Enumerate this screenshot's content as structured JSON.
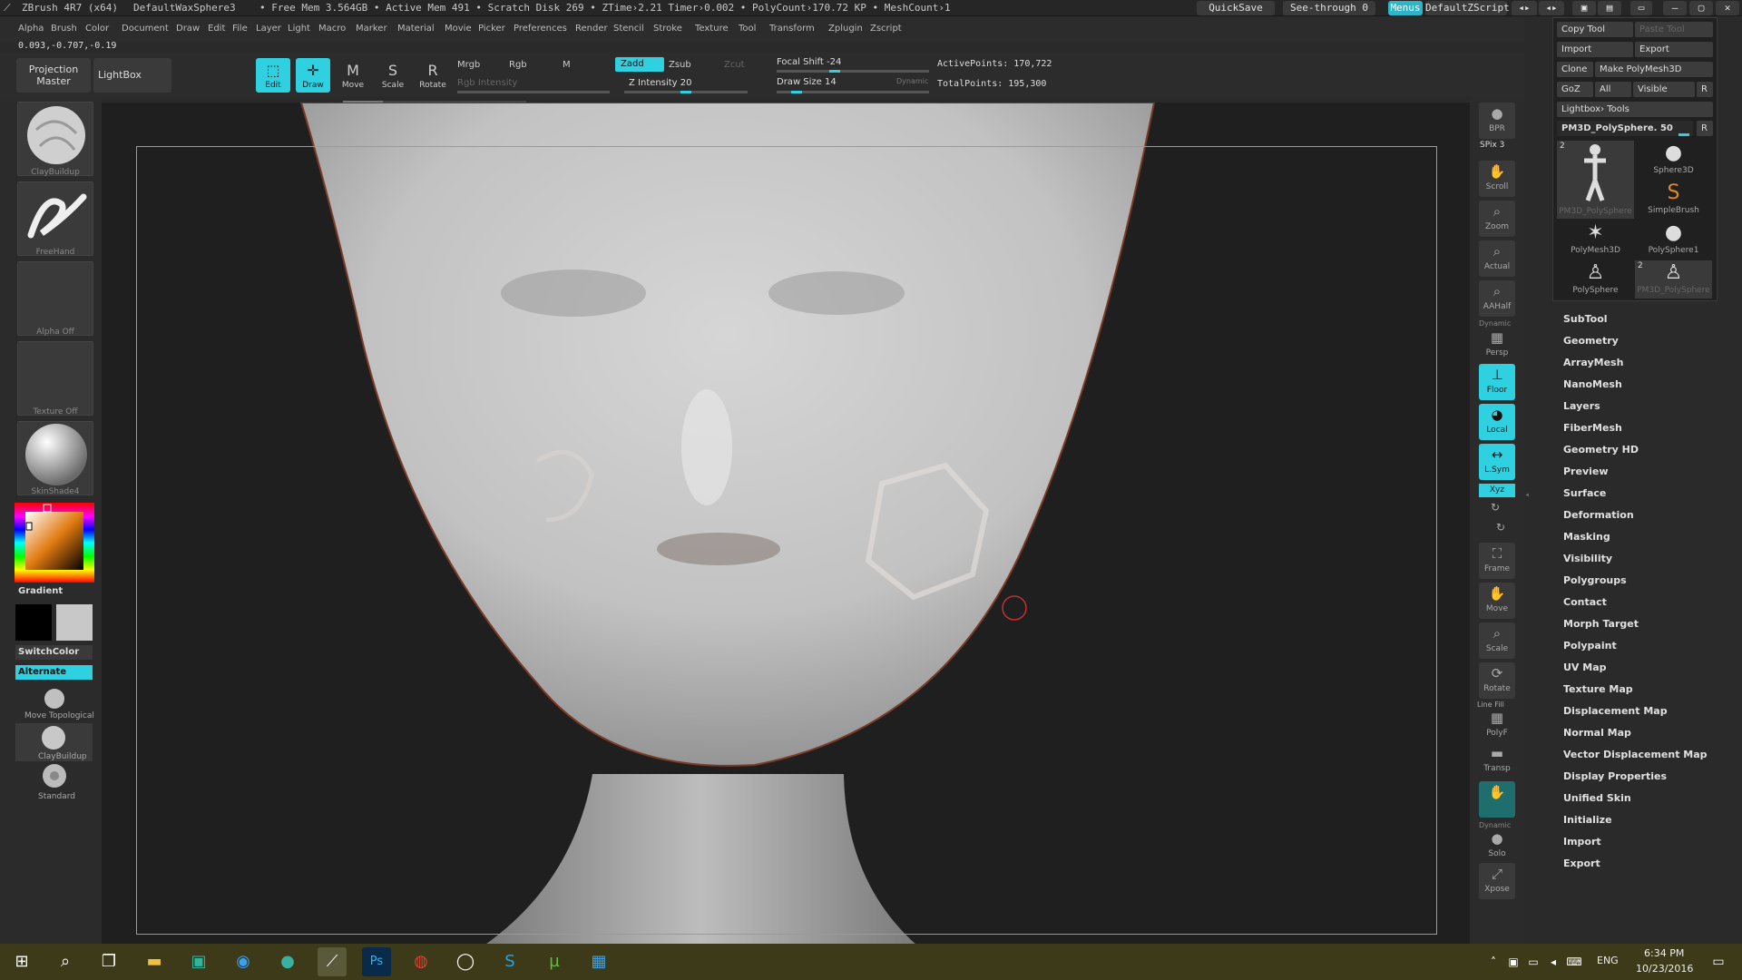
{
  "titlebar": {
    "app": "ZBrush 4R7 (x64)",
    "doc": "DefaultWaxSphere3",
    "stats": "• Free Mem 3.564GB • Active Mem 491 • Scratch Disk 269 • ZTime›2.21 Timer›0.002 • PolyCount›170.72 KP • MeshCount›1",
    "quicksave": "QuickSave",
    "seethrough": "See-through  0",
    "menus": "Menus",
    "script": "DefaultZScript"
  },
  "menubar": [
    "Alpha",
    "Brush",
    "Color",
    "Document",
    "Draw",
    "Edit",
    "File",
    "Layer",
    "Light",
    "Macro",
    "Marker",
    "Material",
    "Movie",
    "Picker",
    "Preferences",
    "Render",
    "Stencil",
    "Stroke",
    "Texture",
    "Tool",
    "Transform",
    "Zplugin",
    "Zscript"
  ],
  "coords": "0.093,-0.707,-0.19",
  "toolbar": {
    "projection_master": "Projection Master",
    "lightbox": "LightBox",
    "edit": "Edit",
    "draw": "Draw",
    "move": "Move",
    "scale": "Scale",
    "rotate": "Rotate",
    "mrgb": "Mrgb",
    "rgb": "Rgb",
    "m": "M",
    "rgb_intensity": "Rgb Intensity",
    "zadd": "Zadd",
    "zsub": "Zsub",
    "zcut": "Zcut",
    "z_intensity": "Z Intensity 20",
    "focal_shift": "Focal Shift -24",
    "draw_size": "Draw Size 14",
    "dynamic": "Dynamic",
    "active_points": "ActivePoints: 170,722",
    "total_points": "TotalPoints: 195,300"
  },
  "left": {
    "brush": "ClayBuildup",
    "stroke": "FreeHand",
    "alpha": "Alpha Off",
    "texture": "Texture Off",
    "material": "SkinShade4",
    "gradient": "Gradient",
    "switchcolor": "SwitchColor",
    "alternate": "Alternate",
    "move_topological": "Move Topological",
    "claybuildup": "ClayBuildup",
    "standard": "Standard"
  },
  "shelf": [
    "BPR",
    "SPix 3",
    "Scroll",
    "Zoom",
    "Actual",
    "AAHalf",
    "Persp",
    "Floor",
    "Local",
    "L.Sym",
    "Xyz",
    "Frame",
    "Move",
    "Scale",
    "Rotate",
    "PolyF",
    "Transp",
    "Ghost",
    "Solo",
    "Xpose"
  ],
  "shelf_labels": {
    "dynamic1": "Dynamic",
    "linefill": "Line Fill",
    "dynamic2": "Dynamic"
  },
  "tray": {
    "copy_tool": "Copy Tool",
    "paste_tool": "Paste Tool",
    "import": "Import",
    "export": "Export",
    "clone": "Clone",
    "make_polymesh": "Make PolyMesh3D",
    "goz": "GoZ",
    "all": "All",
    "visible": "Visible",
    "r": "R",
    "lightbox_tools": "Lightbox› Tools",
    "current_tool": "PM3D_PolySphere. 50",
    "tools": [
      {
        "name": "PM3D_PolySphere",
        "badge": "2"
      },
      {
        "name": "Sphere3D",
        "badge": ""
      },
      {
        "name": "SimpleBrush",
        "badge": ""
      },
      {
        "name": "PolyMesh3D",
        "badge": ""
      },
      {
        "name": "PolySphere1",
        "badge": ""
      },
      {
        "name": "PolySphere",
        "badge": ""
      },
      {
        "name": "PM3D_PolySphere",
        "badge": "2"
      }
    ]
  },
  "tool_menu": [
    "SubTool",
    "Geometry",
    "ArrayMesh",
    "NanoMesh",
    "Layers",
    "FiberMesh",
    "Geometry HD",
    "Preview",
    "Surface",
    "Deformation",
    "Masking",
    "Visibility",
    "Polygroups",
    "Contact",
    "Morph Target",
    "Polypaint",
    "UV Map",
    "Texture Map",
    "Displacement Map",
    "Normal Map",
    "Vector Displacement Map",
    "Display Properties",
    "Unified Skin",
    "Initialize",
    "Import",
    "Export"
  ],
  "taskbar": {
    "lang": "ENG",
    "time": "6:34 PM",
    "date": "10/23/2016"
  }
}
